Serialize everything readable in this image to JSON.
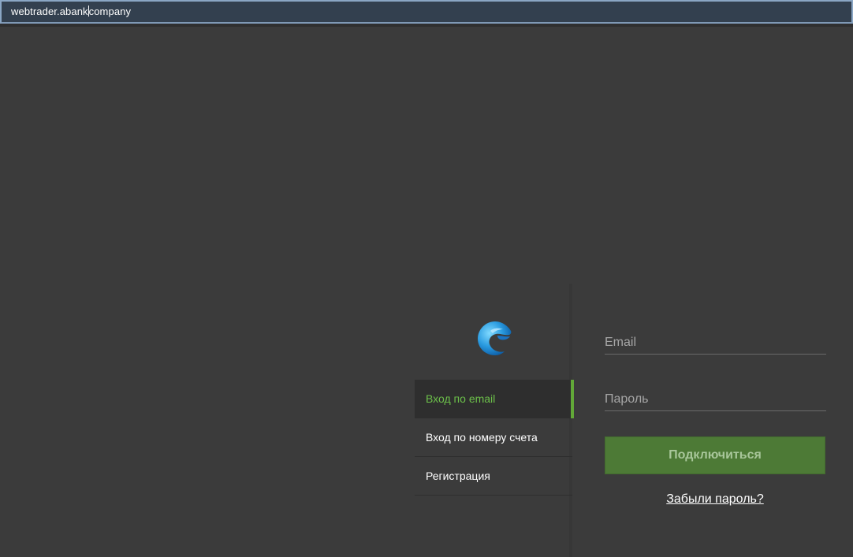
{
  "browser": {
    "address_before_caret": "webtrader.abank",
    "address_after_caret": "company"
  },
  "logo": {
    "icon": "abank-logo-icon",
    "colors": {
      "light": "#6fd0ff",
      "mid": "#2a9be0",
      "dark": "#0c5ea8"
    }
  },
  "login_menu": {
    "items": [
      {
        "label": "Вход по email",
        "active": true
      },
      {
        "label": "Вход по номеру счета",
        "active": false
      },
      {
        "label": "Регистрация",
        "active": false
      }
    ],
    "active_color": "#6cc04a"
  },
  "form": {
    "email_placeholder": "Email",
    "password_placeholder": "Пароль",
    "connect_label": "Подключиться",
    "forgot_label": "Забыли пароль?"
  },
  "colors": {
    "background": "#3b3b3b",
    "button": "#4d7a36"
  }
}
